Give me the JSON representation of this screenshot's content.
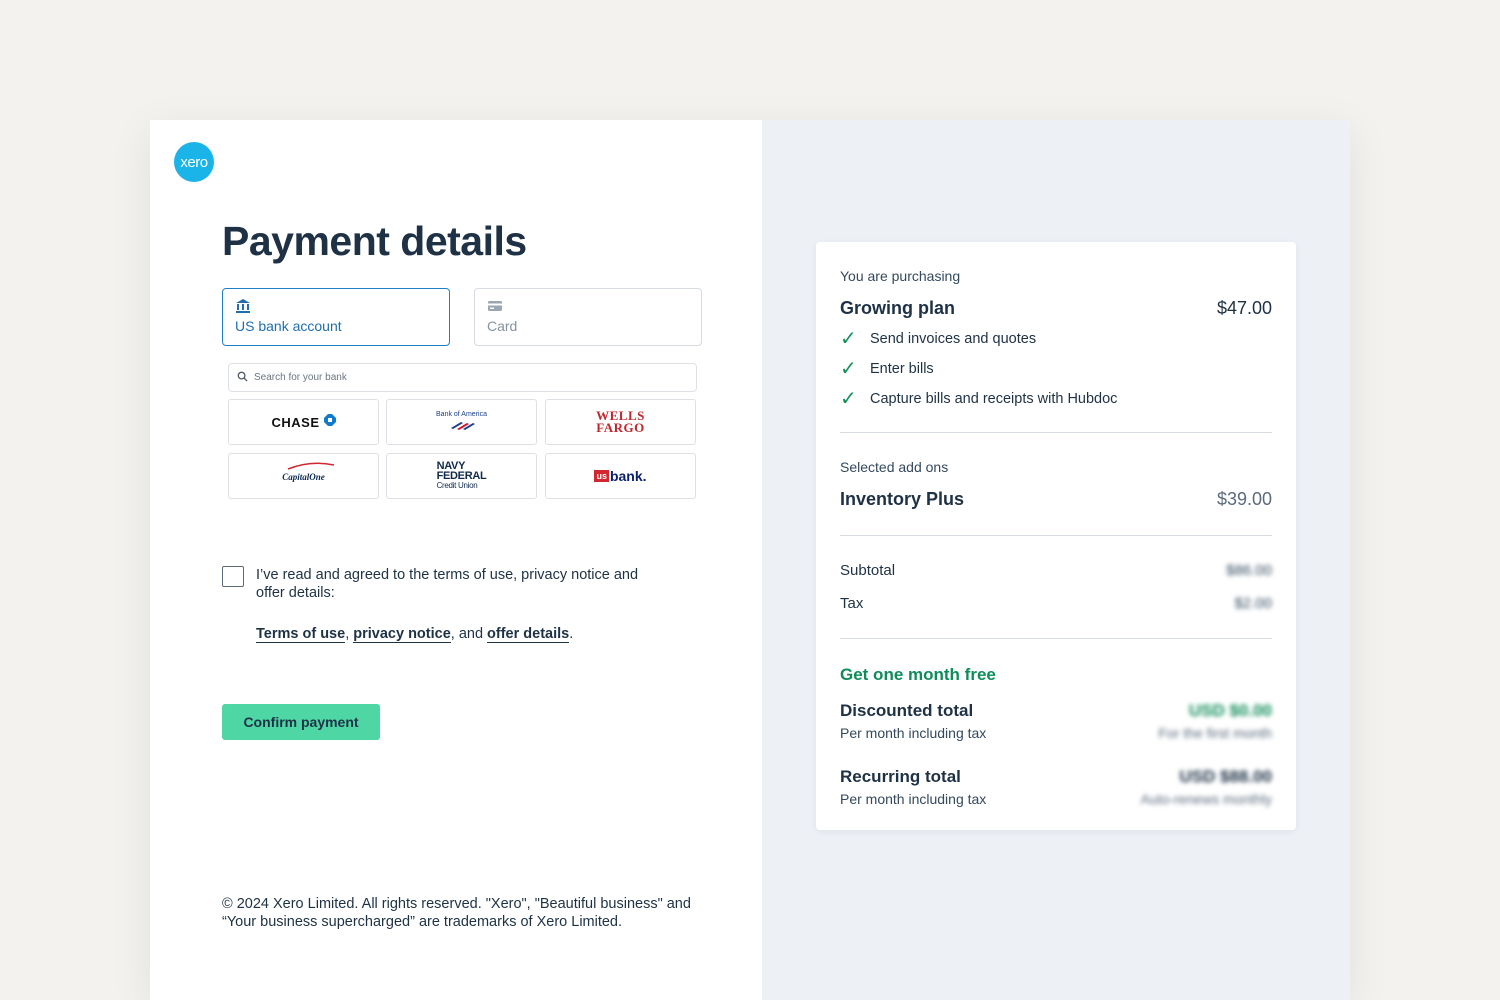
{
  "brand": {
    "logo_text": "xero",
    "logo_color": "#1ab4e8"
  },
  "page": {
    "title": "Payment details"
  },
  "tabs": [
    {
      "label": "US bank account",
      "icon": "bank-icon",
      "active": true
    },
    {
      "label": "Card",
      "icon": "credit-card-icon",
      "active": false
    }
  ],
  "search": {
    "placeholder": "Search for your bank"
  },
  "banks": {
    "chase": "CHASE",
    "boa_line1": "Bank of America",
    "wells_line1": "WELLS",
    "wells_line2": "FARGO",
    "capital_one": "CapitalOne",
    "navy_line1": "NAVY",
    "navy_line2": "FEDERAL",
    "navy_line3": "Credit Union",
    "usbank_badge": "us",
    "usbank_text": "bank."
  },
  "agreement": {
    "text": "I’ve read and agreed to the terms of use, privacy notice and offer details:",
    "link_terms": "Terms of use",
    "sep1": ", ",
    "link_privacy": "privacy notice",
    "sep2": ", and ",
    "link_offer": "offer details",
    "end": "."
  },
  "actions": {
    "confirm_label": "Confirm payment",
    "confirm_color": "#4ed7a5"
  },
  "footer": {
    "text": "© 2024 Xero Limited. All rights reserved. \"Xero\", \"Beautiful business\" and “Your business supercharged” are trademarks of Xero Limited."
  },
  "summary": {
    "purchasing_label": "You are purchasing",
    "plan_name": "Growing plan",
    "plan_price": "$47.00",
    "features": [
      "Send invoices and quotes",
      "Enter bills",
      "Capture bills and receipts with Hubdoc"
    ],
    "addons_label": "Selected add ons",
    "addon_name": "Inventory Plus",
    "addon_price": "$39.00",
    "subtotal_label": "Subtotal",
    "subtotal_value": "$86.00",
    "tax_label": "Tax",
    "tax_value": "$2.00",
    "promo": "Get one month free",
    "discounted_label": "Discounted total",
    "discounted_sub": "Per month including tax",
    "discounted_value": "USD $0.00",
    "discounted_note": "For the first month",
    "recurring_label": "Recurring total",
    "recurring_sub": "Per month including tax",
    "recurring_value": "USD $88.00",
    "recurring_note": "Auto-renews monthly"
  }
}
